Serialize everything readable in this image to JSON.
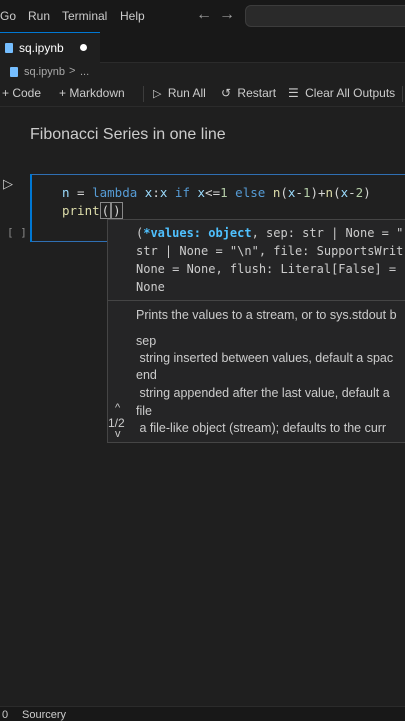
{
  "menubar": {
    "items": [
      "Go",
      "Run",
      "Terminal",
      "Help"
    ],
    "back_arrow": "←",
    "forward_arrow": "→"
  },
  "tab": {
    "label": "sq.ipynb",
    "icon": "notebook-file-icon",
    "dirty_dot": "●"
  },
  "breadcrumb": {
    "file": "sq.ipynb",
    "separator": ">",
    "more": "..."
  },
  "toolbar": {
    "code": "+ Code",
    "markdown": "+ Markdown",
    "run_all": "Run All",
    "restart": "Restart",
    "clear_all": "Clear All Outputs"
  },
  "markdown_cell": {
    "heading": "Fibonacci Series in one line"
  },
  "code_cell": {
    "exec_count": "[ ]",
    "run_icon": "▷",
    "line1": {
      "n": "n",
      "eq": " = ",
      "lambda": "lambda",
      "sp1": " ",
      "x1": "x",
      "colon": ":",
      "x2": "x",
      "sp2": " ",
      "if": "if",
      "sp3": " ",
      "x3": "x",
      "le": "<=",
      "one": "1",
      "sp4": " ",
      "else": "else",
      "sp5": " ",
      "n2": "n",
      "p1": "(",
      "x4": "x",
      "minus1": "-",
      "one2": "1",
      "p2": ")",
      "plus": "+",
      "n3": "n",
      "p3": "(",
      "x5": "x",
      "minus2": "-",
      "two": "2",
      "p4": ")"
    },
    "line2": {
      "print": "print",
      "open": "(",
      "close": ")"
    }
  },
  "signature_help": {
    "sig_line1_open": "(",
    "sig_line1_hl": "*values: object",
    "sig_line1_rest": ", sep: str | None = \"",
    "sig_line2": "str | None = \"\\n\", file: SupportsWrit",
    "sig_line3": "None = None, flush: Literal[False] =",
    "sig_line4": "None",
    "doc_summary": "Prints the values to a stream, or to sys.stdout b",
    "doc_sep_name": "sep",
    "doc_sep_desc": " string inserted between values, default a spac",
    "doc_end_name": "end",
    "doc_end_desc": " string appended after the last value, default a",
    "doc_file_name": "file",
    "doc_file_desc": " a file-like object (stream); defaults to the curr",
    "nav_up": "^",
    "nav_count": "1/2",
    "nav_down": "v"
  },
  "statusbar": {
    "left": "0",
    "extension": "Sourcery"
  }
}
